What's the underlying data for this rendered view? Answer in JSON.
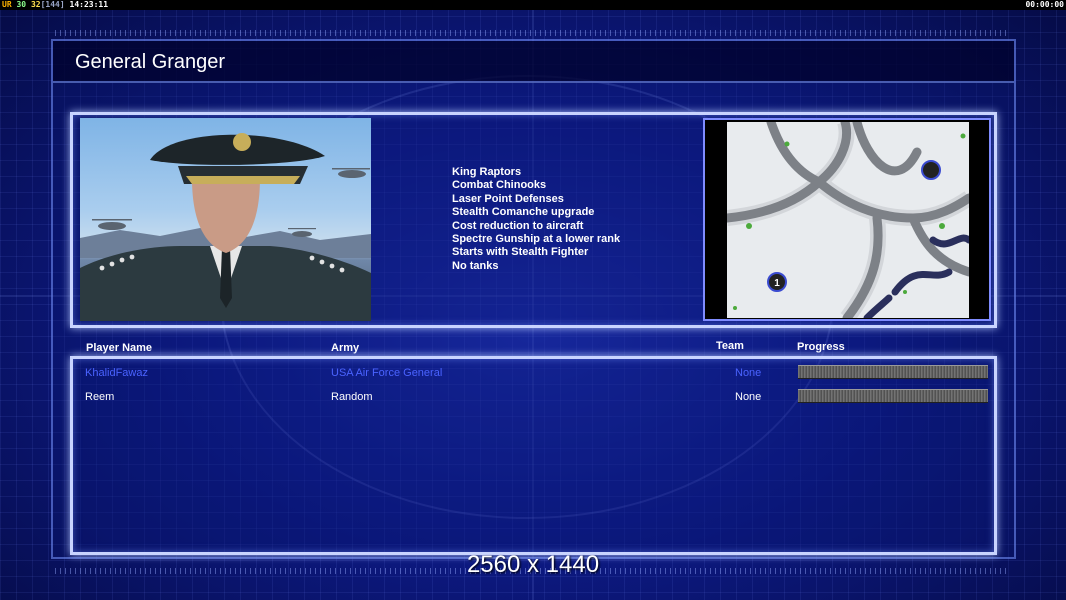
{
  "hud": {
    "ur": "UR",
    "fps": "30",
    "fps_target": "32",
    "refresh": "[144]",
    "clock": "14:23:11",
    "timer": "00:00:00"
  },
  "screen": {
    "title": "General Granger",
    "resolution": "2560 x 1440"
  },
  "general": {
    "features": [
      "King Raptors",
      "Combat Chinooks",
      "Laser Point Defenses",
      "Stealth Comanche upgrade",
      "Cost reduction to aircraft",
      "Spectre Gunship at a lower rank",
      "Starts with Stealth Fighter",
      "No tanks"
    ]
  },
  "map": {
    "start_marker": "1"
  },
  "players": {
    "headers": {
      "name": "Player Name",
      "army": "Army",
      "team": "Team",
      "progress": "Progress"
    },
    "rows": [
      {
        "name": "KhalidFawaz",
        "army": "USA Air Force General",
        "team": "None",
        "color": "#4a63ff"
      },
      {
        "name": "Reem",
        "army": "Random",
        "team": "None",
        "color": "#ffffff"
      }
    ]
  }
}
